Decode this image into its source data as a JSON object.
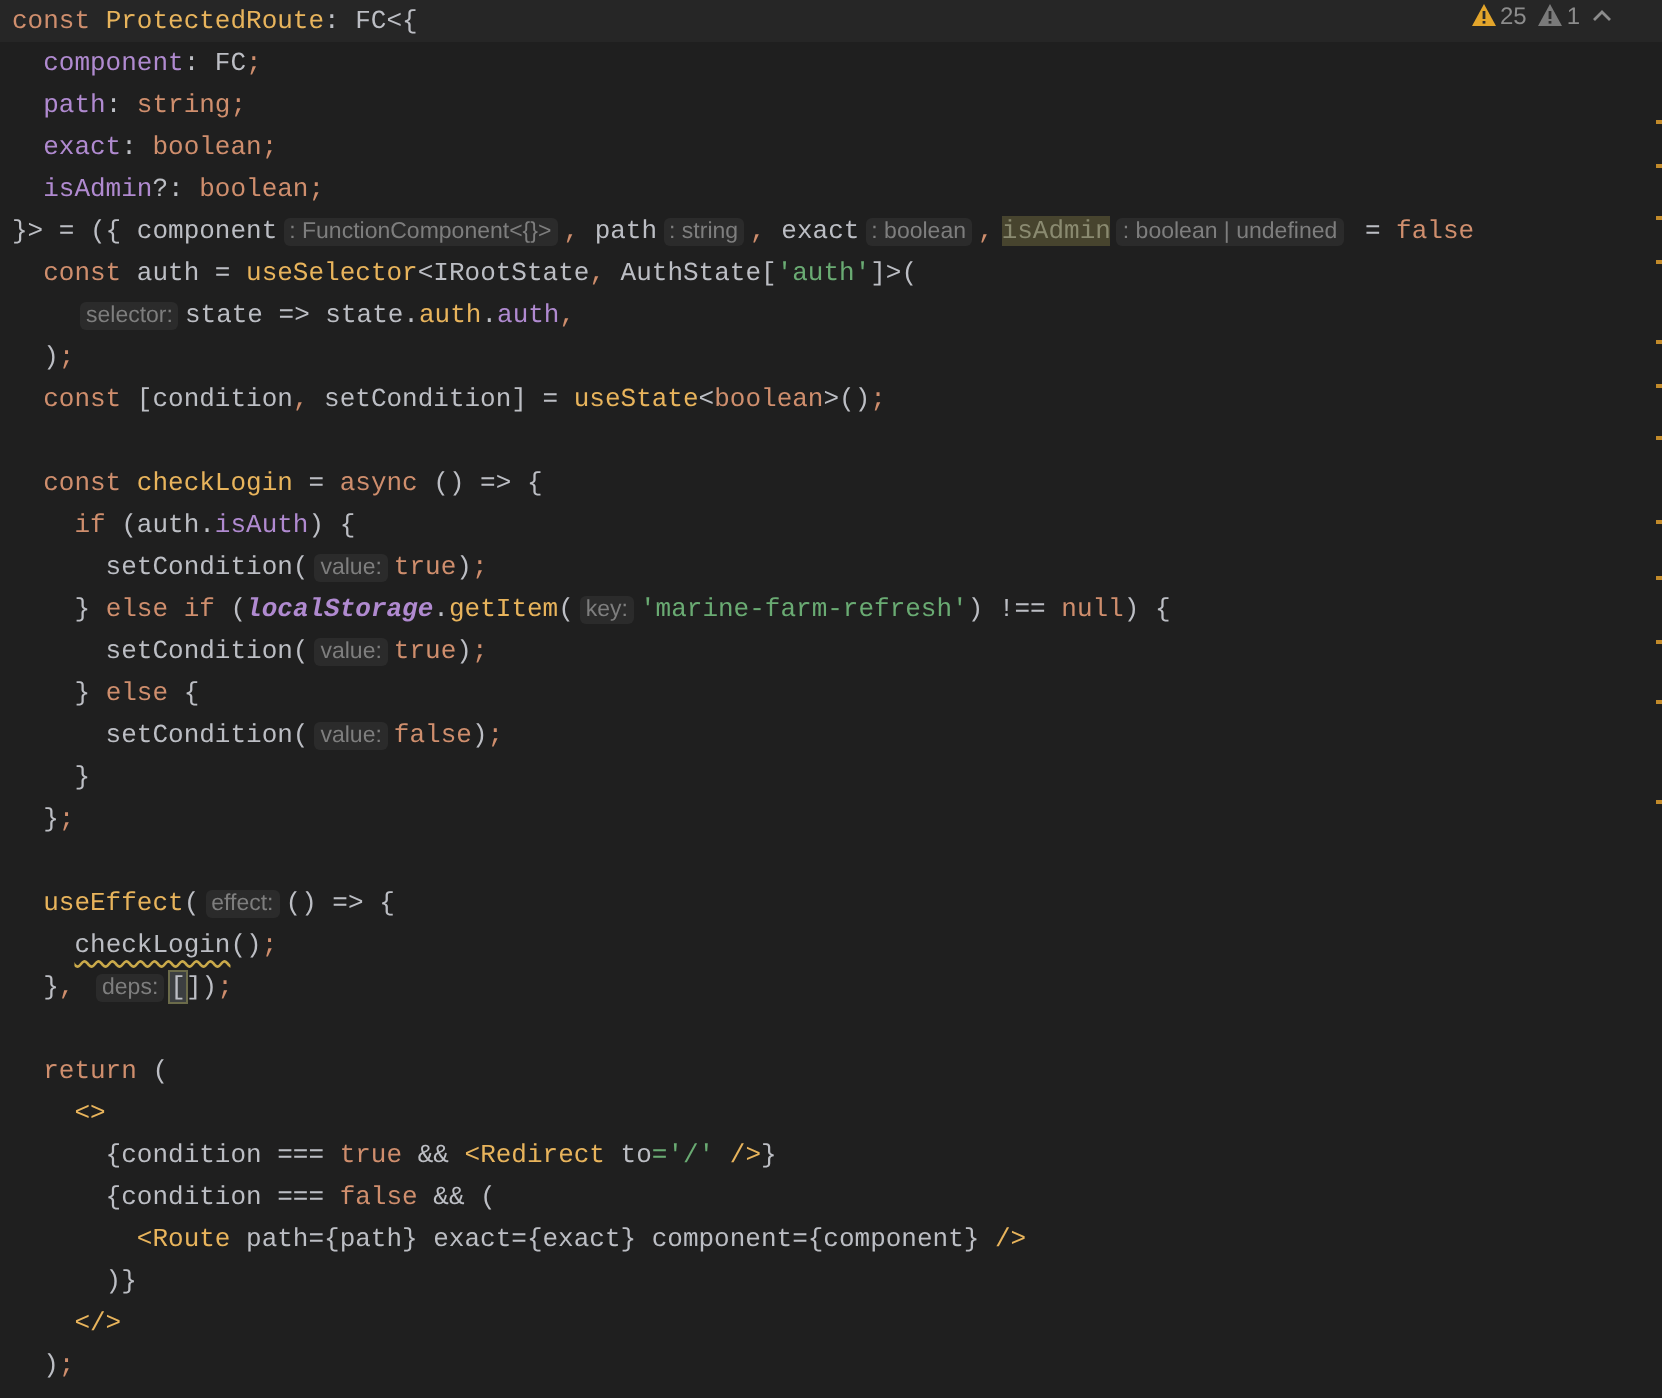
{
  "inspection_widget": {
    "problems": [
      {
        "kind": "warning",
        "count": "25"
      },
      {
        "kind": "weak",
        "count": "1"
      }
    ]
  },
  "lines": [
    {
      "kind": "code",
      "tokens": [
        {
          "kind": "keyword",
          "text": "const "
        },
        {
          "kind": "function",
          "text": "ProtectedRoute"
        },
        {
          "kind": "plain",
          "text": ": FC<{"
        }
      ]
    },
    {
      "kind": "code",
      "tokens": [
        {
          "kind": "property",
          "text": "  component"
        },
        {
          "kind": "plain",
          "text": ": FC"
        },
        {
          "kind": "keyword",
          "text": ";"
        }
      ]
    },
    {
      "kind": "code",
      "tokens": [
        {
          "kind": "property",
          "text": "  path"
        },
        {
          "kind": "plain",
          "text": ": "
        },
        {
          "kind": "keyword",
          "text": "string;"
        }
      ]
    },
    {
      "kind": "code",
      "tokens": [
        {
          "kind": "property",
          "text": "  exact"
        },
        {
          "kind": "plain",
          "text": ": "
        },
        {
          "kind": "keyword",
          "text": "boolean;"
        }
      ]
    },
    {
      "kind": "code",
      "tokens": [
        {
          "kind": "property",
          "text": "  isAdmin"
        },
        {
          "kind": "plain",
          "text": "?: "
        },
        {
          "kind": "keyword",
          "text": "boolean;"
        }
      ]
    },
    {
      "kind": "code",
      "tokens": [
        {
          "kind": "plain",
          "text": "}> = ({ component"
        },
        {
          "kind": "hint",
          "text": ": FunctionComponent<{}>"
        },
        {
          "kind": "keyword",
          "text": ","
        },
        {
          "kind": "plain",
          "text": " path"
        },
        {
          "kind": "hint",
          "text": ": string"
        },
        {
          "kind": "keyword",
          "text": ","
        },
        {
          "kind": "plain",
          "text": " exact"
        },
        {
          "kind": "hint",
          "text": ": boolean"
        },
        {
          "kind": "keyword",
          "text": ","
        },
        {
          "kind": "highlight",
          "text": "isAdmin"
        },
        {
          "kind": "hint",
          "text": ": boolean | undefined"
        },
        {
          "kind": "plain",
          "text": " = "
        },
        {
          "kind": "keyword",
          "text": "false"
        }
      ]
    },
    {
      "kind": "code",
      "tokens": [
        {
          "kind": "keyword",
          "text": "  const "
        },
        {
          "kind": "plain",
          "text": "auth = "
        },
        {
          "kind": "function",
          "text": "useSelector"
        },
        {
          "kind": "plain",
          "text": "<IRootState"
        },
        {
          "kind": "keyword",
          "text": ", "
        },
        {
          "kind": "plain",
          "text": "AuthState["
        },
        {
          "kind": "string",
          "text": "'auth'"
        },
        {
          "kind": "plain",
          "text": "]>("
        }
      ]
    },
    {
      "kind": "code",
      "tokens": [
        {
          "kind": "hint",
          "text": "selector:"
        },
        {
          "kind": "plain",
          "text": "state => state."
        },
        {
          "kind": "function",
          "text": "auth"
        },
        {
          "kind": "plain",
          "text": "."
        },
        {
          "kind": "property",
          "text": "auth"
        },
        {
          "kind": "keyword",
          "text": ","
        }
      ]
    },
    {
      "kind": "code",
      "tokens": [
        {
          "kind": "plain",
          "text": "  )"
        },
        {
          "kind": "keyword",
          "text": ";"
        }
      ]
    },
    {
      "kind": "code",
      "tokens": [
        {
          "kind": "keyword",
          "text": "  const "
        },
        {
          "kind": "plain",
          "text": "[condition"
        },
        {
          "kind": "keyword",
          "text": ", "
        },
        {
          "kind": "plain",
          "text": "setCondition] = "
        },
        {
          "kind": "function",
          "text": "useState"
        },
        {
          "kind": "plain",
          "text": "<"
        },
        {
          "kind": "keyword",
          "text": "boolean"
        },
        {
          "kind": "plain",
          "text": ">()"
        },
        {
          "kind": "keyword",
          "text": ";"
        }
      ]
    },
    {
      "kind": "blank"
    },
    {
      "kind": "code",
      "tokens": [
        {
          "kind": "keyword",
          "text": "  const "
        },
        {
          "kind": "function",
          "text": "checkLogin"
        },
        {
          "kind": "plain",
          "text": " = "
        },
        {
          "kind": "keyword",
          "text": "async "
        },
        {
          "kind": "plain",
          "text": "() => {"
        }
      ]
    },
    {
      "kind": "code",
      "tokens": [
        {
          "kind": "keyword",
          "text": "    if "
        },
        {
          "kind": "plain",
          "text": "(auth."
        },
        {
          "kind": "property",
          "text": "isAuth"
        },
        {
          "kind": "plain",
          "text": ") {"
        }
      ]
    },
    {
      "kind": "code",
      "tokens": [
        {
          "kind": "plain",
          "text": "      setCondition("
        },
        {
          "kind": "hint",
          "text": "value:"
        },
        {
          "kind": "keyword",
          "text": "true"
        },
        {
          "kind": "plain",
          "text": ")"
        },
        {
          "kind": "keyword",
          "text": ";"
        }
      ]
    },
    {
      "kind": "code",
      "tokens": [
        {
          "kind": "plain",
          "text": "    } "
        },
        {
          "kind": "keyword",
          "text": "else if "
        },
        {
          "kind": "plain",
          "text": "("
        },
        {
          "kind": "global",
          "text": "localStorage"
        },
        {
          "kind": "plain",
          "text": "."
        },
        {
          "kind": "function",
          "text": "getItem"
        },
        {
          "kind": "plain",
          "text": "("
        },
        {
          "kind": "hint",
          "text": "key:"
        },
        {
          "kind": "string",
          "text": "'marine-farm-refresh'"
        },
        {
          "kind": "plain",
          "text": ") !== "
        },
        {
          "kind": "keyword",
          "text": "null"
        },
        {
          "kind": "plain",
          "text": ") {"
        }
      ]
    },
    {
      "kind": "code",
      "tokens": [
        {
          "kind": "plain",
          "text": "      setCondition("
        },
        {
          "kind": "hint",
          "text": "value:"
        },
        {
          "kind": "keyword",
          "text": "true"
        },
        {
          "kind": "plain",
          "text": ")"
        },
        {
          "kind": "keyword",
          "text": ";"
        }
      ]
    },
    {
      "kind": "code",
      "tokens": [
        {
          "kind": "plain",
          "text": "    } "
        },
        {
          "kind": "keyword",
          "text": "else "
        },
        {
          "kind": "plain",
          "text": "{"
        }
      ]
    },
    {
      "kind": "code",
      "tokens": [
        {
          "kind": "plain",
          "text": "      setCondition("
        },
        {
          "kind": "hint",
          "text": "value:"
        },
        {
          "kind": "keyword",
          "text": "false"
        },
        {
          "kind": "plain",
          "text": ")"
        },
        {
          "kind": "keyword",
          "text": ";"
        }
      ]
    },
    {
      "kind": "code",
      "tokens": [
        {
          "kind": "plain",
          "text": "    }"
        }
      ]
    },
    {
      "kind": "code",
      "tokens": [
        {
          "kind": "plain",
          "text": "  }"
        },
        {
          "kind": "keyword",
          "text": ";"
        }
      ]
    },
    {
      "kind": "blank"
    },
    {
      "kind": "code",
      "tokens": [
        {
          "kind": "function",
          "text": "  useEffect"
        },
        {
          "kind": "plain",
          "text": "("
        },
        {
          "kind": "hint",
          "text": "effect:"
        },
        {
          "kind": "plain",
          "text": "() => {"
        }
      ]
    },
    {
      "kind": "code",
      "tokens": [
        {
          "kind": "warning",
          "text": "    checkLogin"
        },
        {
          "kind": "plain",
          "text": "()"
        },
        {
          "kind": "keyword",
          "text": ";"
        }
      ]
    },
    {
      "kind": "code",
      "tokens": [
        {
          "kind": "plain",
          "text": "  }"
        },
        {
          "kind": "keyword",
          "text": ", "
        },
        {
          "kind": "hint",
          "text": "deps:"
        },
        {
          "kind": "caret",
          "text": "["
        },
        {
          "kind": "plain",
          "text": "])"
        },
        {
          "kind": "keyword",
          "text": ";"
        }
      ]
    },
    {
      "kind": "blank"
    },
    {
      "kind": "code",
      "tokens": [
        {
          "kind": "keyword",
          "text": "  return "
        },
        {
          "kind": "plain",
          "text": "("
        }
      ]
    },
    {
      "kind": "code",
      "tokens": [
        {
          "kind": "tag",
          "text": "    <>"
        }
      ]
    },
    {
      "kind": "code",
      "tokens": [
        {
          "kind": "plain",
          "text": "      {condition === "
        },
        {
          "kind": "keyword",
          "text": "true"
        },
        {
          "kind": "plain",
          "text": " && "
        },
        {
          "kind": "tag",
          "text": "<Redirect"
        },
        {
          "kind": "plain",
          "text": " to"
        },
        {
          "kind": "string",
          "text": "='/'"
        },
        {
          "kind": "tag",
          "text": " />"
        },
        {
          "kind": "plain",
          "text": "}"
        }
      ]
    },
    {
      "kind": "code",
      "tokens": [
        {
          "kind": "plain",
          "text": "      {condition === "
        },
        {
          "kind": "keyword",
          "text": "false"
        },
        {
          "kind": "plain",
          "text": " && ("
        }
      ]
    },
    {
      "kind": "code",
      "tokens": [
        {
          "kind": "tag",
          "text": "        <Route"
        },
        {
          "kind": "plain",
          "text": " path={path} exact={exact} component={component}"
        },
        {
          "kind": "tag",
          "text": " />"
        }
      ]
    },
    {
      "kind": "code",
      "tokens": [
        {
          "kind": "plain",
          "text": "      )}"
        }
      ]
    },
    {
      "kind": "code",
      "tokens": [
        {
          "kind": "tag",
          "text": "    </>"
        }
      ]
    },
    {
      "kind": "code",
      "tokens": [
        {
          "kind": "plain",
          "text": "  )"
        },
        {
          "kind": "keyword",
          "text": ";"
        }
      ]
    }
  ]
}
